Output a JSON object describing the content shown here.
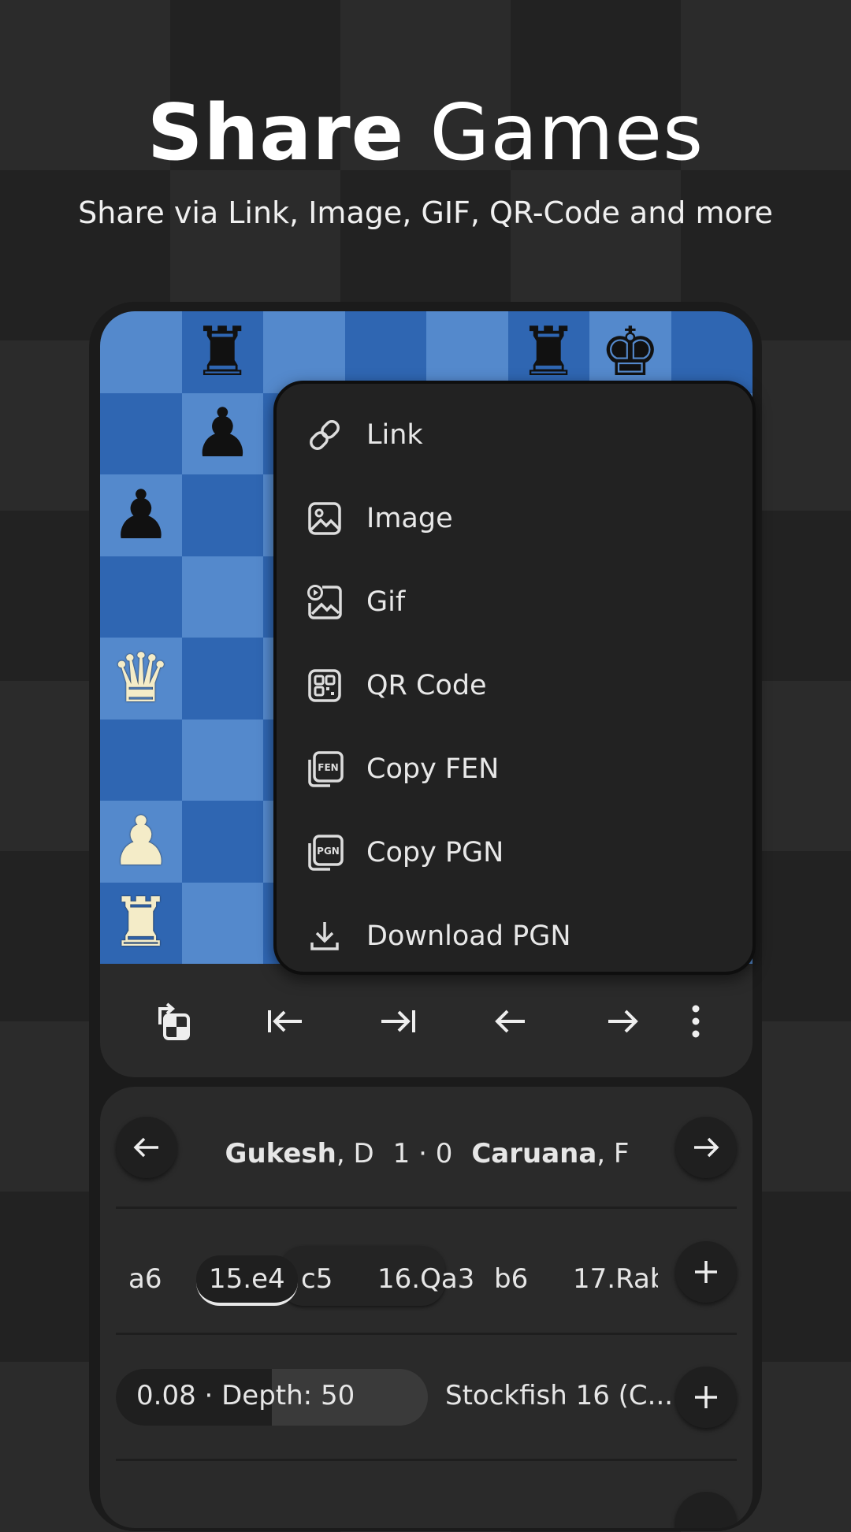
{
  "hero": {
    "title_bold": "Share",
    "title_light": "Games",
    "subtitle": "Share via Link, Image, GIF, QR-Code and more"
  },
  "board": {
    "light_color": "#5489cc",
    "dark_color": "#2f66b2",
    "pieces": [
      {
        "square": "b8",
        "glyph": "♜",
        "color": "black",
        "icon": "black-rook-icon"
      },
      {
        "square": "f8",
        "glyph": "♜",
        "color": "black",
        "icon": "black-rook-icon"
      },
      {
        "square": "g8",
        "glyph": "♚",
        "color": "black",
        "icon": "black-king-icon"
      },
      {
        "square": "b7",
        "glyph": "♟",
        "color": "black",
        "icon": "black-pawn-icon"
      },
      {
        "square": "a6",
        "glyph": "♟",
        "color": "black",
        "icon": "black-pawn-icon"
      },
      {
        "square": "a4",
        "glyph": "♛",
        "color": "white",
        "icon": "white-queen-icon"
      },
      {
        "square": "a2",
        "glyph": "♟",
        "color": "white",
        "icon": "white-pawn-icon"
      },
      {
        "square": "a1",
        "glyph": "♜",
        "color": "white",
        "icon": "white-rook-icon"
      }
    ]
  },
  "share_menu": {
    "items": [
      {
        "label": "Link",
        "icon": "link-icon"
      },
      {
        "label": "Image",
        "icon": "image-icon"
      },
      {
        "label": "Gif",
        "icon": "gif-icon"
      },
      {
        "label": "QR Code",
        "icon": "qr-code-icon"
      },
      {
        "label": "Copy FEN",
        "icon": "copy-fen-icon",
        "badge": "FEN"
      },
      {
        "label": "Copy PGN",
        "icon": "copy-pgn-icon",
        "badge": "PGN"
      },
      {
        "label": "Download PGN",
        "icon": "download-icon"
      }
    ]
  },
  "toolbar": {
    "buttons": [
      "flip-board-icon",
      "first-move-icon",
      "last-move-icon",
      "previous-move-icon",
      "next-move-icon",
      "more-options-icon"
    ]
  },
  "game": {
    "white_name": "Gukesh",
    "white_initial": ", D",
    "result": "1 · 0",
    "black_name": "Caruana",
    "black_initial": ", F"
  },
  "moves": {
    "items": [
      "a6",
      "15.e4",
      "c5",
      "16.Qa3",
      "b6",
      "17.Rab"
    ],
    "current_index": 1
  },
  "engine": {
    "evaluation": "0.08 · Depth: 50",
    "name": "Stockfish 16 (C...",
    "bar_fraction": 0.5
  },
  "colors": {
    "accent": "#e8e8e8",
    "card": "#2a2a2a",
    "menu": "#222222"
  }
}
